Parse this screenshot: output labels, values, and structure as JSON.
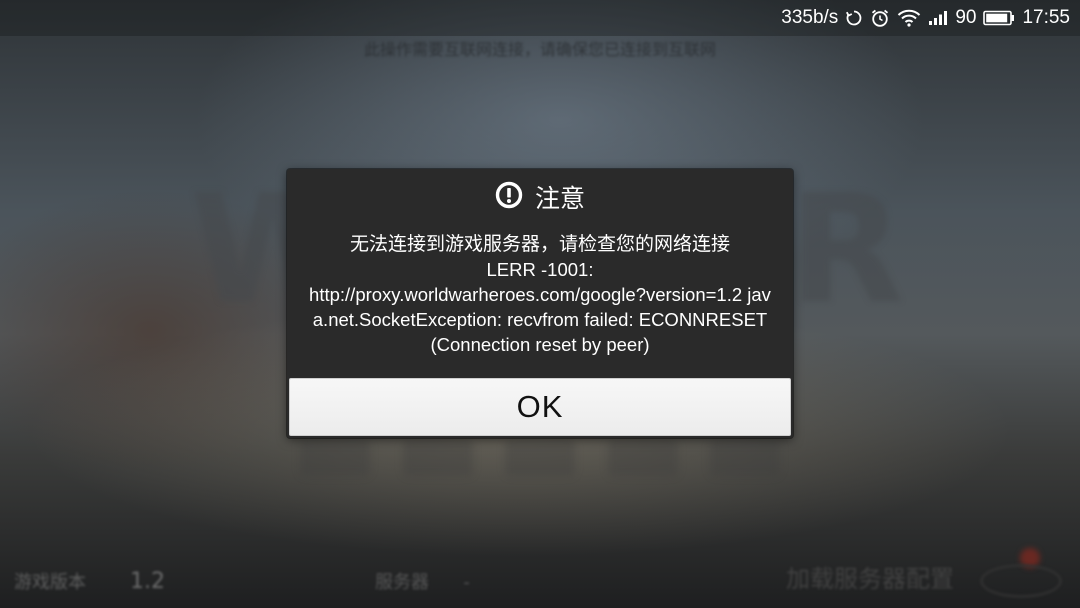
{
  "status_bar": {
    "network_speed": "335b/s",
    "battery_level": "90",
    "time": "17:55",
    "icons": [
      "sync-icon",
      "alarm-icon",
      "wifi-icon",
      "signal-icon",
      "battery-icon"
    ]
  },
  "background": {
    "hint": "此操作需要互联网连接，请确保您已连接到互联网",
    "bottom_left_label": "游戏版本",
    "version": "1.2",
    "bottom_mid_label": "服务器",
    "bottom_mid_value": "-",
    "loading_text": "加载服务器配置"
  },
  "dialog": {
    "icon": "alert-circle-icon",
    "title": "注意",
    "message_line1": "无法连接到游戏服务器，请检查您的网络连接",
    "message_line2": "LERR -1001:",
    "message_error": "http://proxy.worldwarheroes.com/google?version=1.2 java.net.SocketException: recvfrom failed: ECONNRESET (Connection reset by peer)",
    "ok_label": "OK"
  },
  "colors": {
    "dialog_background": "#2a2a2a",
    "button_background": "#f2f2f2",
    "text_light": "#ffffff",
    "text_dark": "#111111"
  }
}
